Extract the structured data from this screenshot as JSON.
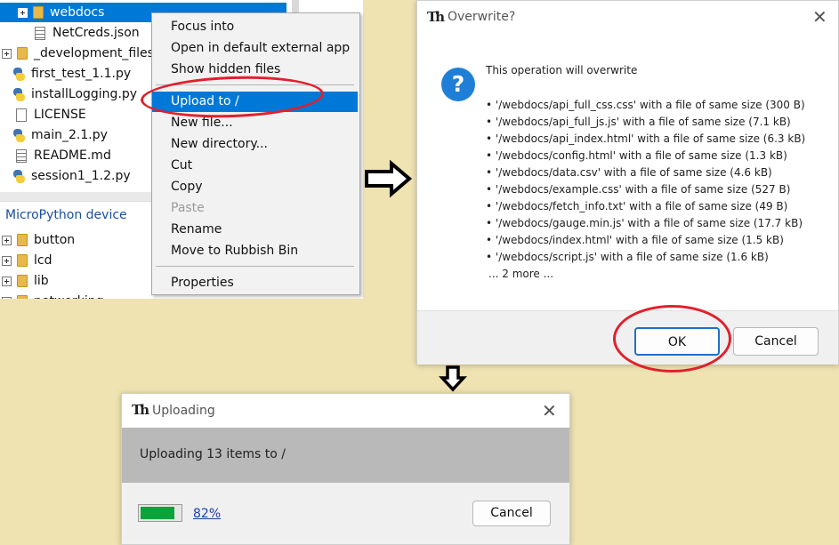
{
  "tree": {
    "items": [
      {
        "label": "webdocs",
        "icon": "folder-icon",
        "expandable": true,
        "selected": true
      },
      {
        "label": "NetCreds.json",
        "icon": "file-lines-icon",
        "expandable": false
      },
      {
        "label": "_development_files",
        "icon": "folder-icon",
        "expandable": true
      },
      {
        "label": "first_test_1.1.py",
        "icon": "python-icon",
        "expandable": false
      },
      {
        "label": "installLogging.py",
        "icon": "python-icon",
        "expandable": false
      },
      {
        "label": "LICENSE",
        "icon": "file-icon",
        "expandable": false
      },
      {
        "label": "main_2.1.py",
        "icon": "python-icon",
        "expandable": false
      },
      {
        "label": "README.md",
        "icon": "file-lines-icon",
        "expandable": false
      },
      {
        "label": "session1_1.2.py",
        "icon": "python-icon",
        "expandable": false
      }
    ],
    "device_header": "MicroPython device",
    "device_items": [
      {
        "label": "button",
        "icon": "folder-icon"
      },
      {
        "label": "lcd",
        "icon": "folder-icon"
      },
      {
        "label": "lib",
        "icon": "folder-icon"
      },
      {
        "label": "networking",
        "icon": "folder-icon"
      }
    ]
  },
  "context_menu": {
    "items": [
      {
        "label": "Focus into",
        "state": "normal"
      },
      {
        "label": "Open in default external app",
        "state": "normal"
      },
      {
        "label": "Show hidden files",
        "state": "normal"
      },
      {
        "label": "Upload to /",
        "state": "active"
      },
      {
        "label": "New file...",
        "state": "normal"
      },
      {
        "label": "New directory...",
        "state": "normal"
      },
      {
        "label": "Cut",
        "state": "normal"
      },
      {
        "label": "Copy",
        "state": "normal"
      },
      {
        "label": "Paste",
        "state": "disabled"
      },
      {
        "label": "Rename",
        "state": "normal"
      },
      {
        "label": "Move to Rubbish Bin",
        "state": "normal"
      },
      {
        "label": "Properties",
        "state": "normal"
      }
    ]
  },
  "overwrite_dialog": {
    "app_logo": "Th",
    "title": "Overwrite?",
    "close_glyph": "✕",
    "message": "This operation will overwrite",
    "lines": [
      "• '/webdocs/api_full_css.css' with a file of same size (300 B)",
      "• '/webdocs/api_full_js.js' with a file of same size (7.1 kB)",
      "• '/webdocs/api_index.html' with a file of same size (6.3 kB)",
      "• '/webdocs/config.html' with a file of same size (1.3 kB)",
      "• '/webdocs/data.csv' with a file of same size (4.6 kB)",
      "• '/webdocs/example.css' with a file of same size (527 B)",
      "• '/webdocs/fetch_info.txt' with a file of same size (49 B)",
      "• '/webdocs/gauge.min.js' with a file of same size (17.7 kB)",
      "• '/webdocs/index.html' with a file of same size (1.5 kB)",
      "• '/webdocs/script.js' with a file of same size (1.6 kB)"
    ],
    "more": "... 2 more ...",
    "ok_label": "OK",
    "cancel_label": "Cancel"
  },
  "uploading_dialog": {
    "app_logo": "Th",
    "title": "Uploading",
    "close_glyph": "✕",
    "message": "Uploading 13 items to /",
    "progress_percent": 82,
    "progress_label": "82%",
    "cancel_label": "Cancel"
  },
  "annotation_color": "#e0202c",
  "progress_color": "#0aa53a",
  "selection_color": "#0078d7"
}
